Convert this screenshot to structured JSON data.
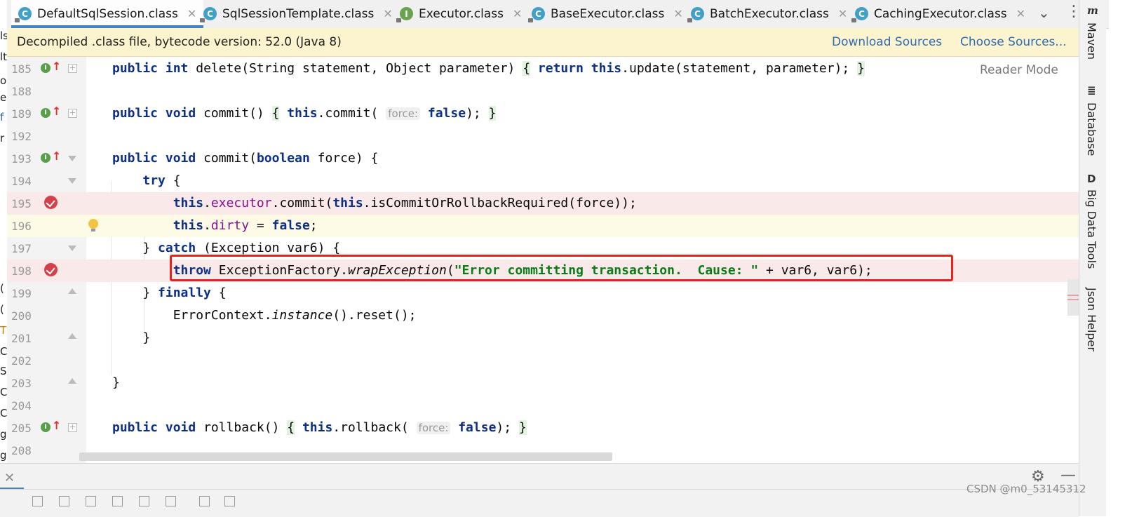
{
  "tabs": [
    {
      "label": "DefaultSqlSession.class",
      "icon": "class-icon",
      "kind": "C",
      "active": true
    },
    {
      "label": "SqlSessionTemplate.class",
      "icon": "class-icon",
      "kind": "C"
    },
    {
      "label": "Executor.class",
      "icon": "interface-icon",
      "kind": "I"
    },
    {
      "label": "BaseExecutor.class",
      "icon": "class-icon",
      "kind": "C"
    },
    {
      "label": "BatchExecutor.class",
      "icon": "class-icon",
      "kind": "C"
    },
    {
      "label": "CachingExecutor.class",
      "icon": "class-icon",
      "kind": "C"
    }
  ],
  "banner": {
    "text": "Decompiled .class file, bytecode version: 52.0 (Java 8)",
    "download_sources": "Download Sources",
    "choose_sources": "Choose Sources..."
  },
  "editor": {
    "reader_mode": "Reader Mode",
    "line_numbers": [
      "185",
      "188",
      "189",
      "192",
      "193",
      "194",
      "195",
      "196",
      "197",
      "198",
      "199",
      "200",
      "201",
      "202",
      "203",
      "204",
      "205",
      "208"
    ],
    "hint_force": "force:"
  },
  "right_tools": [
    "Maven",
    "Database",
    "Big Data Tools",
    "Json Helper"
  ],
  "left_strip_chars": [
    "ls",
    "lt",
    "o",
    "e",
    "f",
    "r",
    "(",
    "(",
    "T",
    "C",
    "S",
    "C",
    "C",
    "g",
    "g"
  ],
  "watermark": "CSDN @m0_53145312",
  "colors": {
    "keyword": "#0b2f8a",
    "string": "#067d17",
    "field": "#871094",
    "highlight_box": "#e8221e",
    "link": "#2f6cb5",
    "banner_bg": "#fcf4cf"
  }
}
